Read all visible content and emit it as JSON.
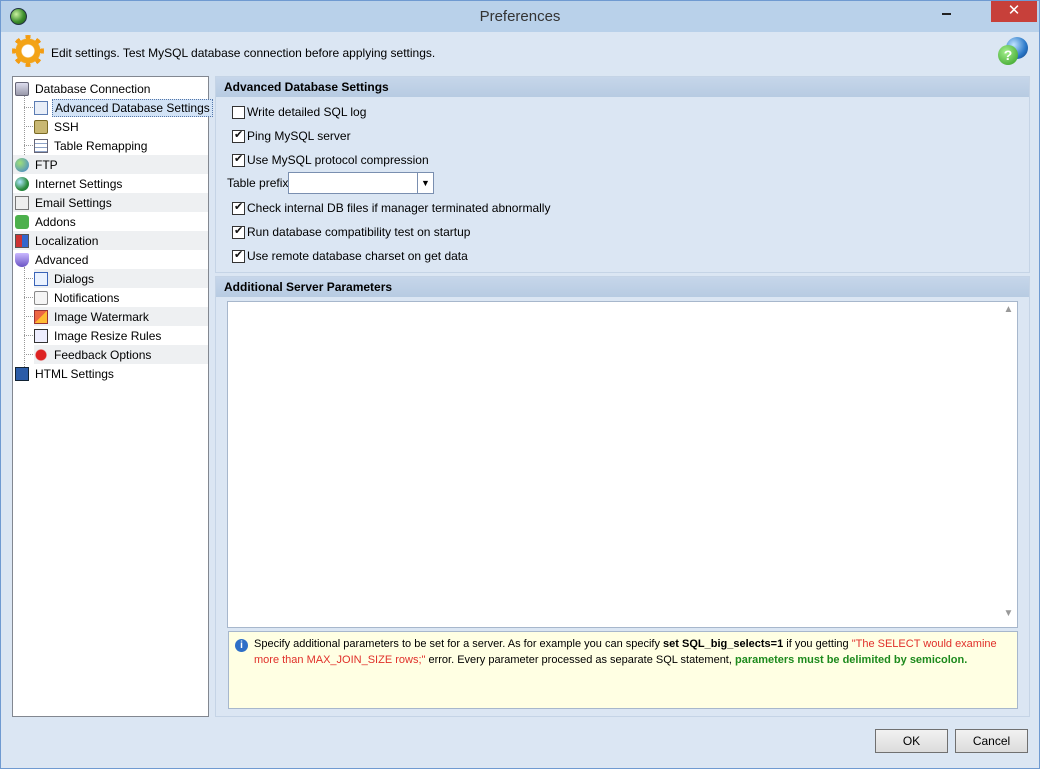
{
  "window": {
    "title": "Preferences",
    "close_glyph": "✕"
  },
  "header": {
    "text": "Edit settings. Test MySQL database connection before applying settings.",
    "help_glyph": "?"
  },
  "tree": {
    "items": [
      {
        "label": "Database Connection",
        "icon": "database-icon"
      },
      {
        "label": "Advanced Database Settings",
        "icon": "document-icon",
        "selected": true
      },
      {
        "label": "SSH",
        "icon": "lock-icon"
      },
      {
        "label": "Table Remapping",
        "icon": "table-icon"
      },
      {
        "label": "FTP",
        "icon": "ftp-icon"
      },
      {
        "label": "Internet Settings",
        "icon": "globe-icon"
      },
      {
        "label": "Email Settings",
        "icon": "envelope-icon"
      },
      {
        "label": "Addons",
        "icon": "puzzle-icon"
      },
      {
        "label": "Localization",
        "icon": "flag-icon"
      },
      {
        "label": "Advanced",
        "icon": "shield-icon"
      },
      {
        "label": "Dialogs",
        "icon": "dialog-icon"
      },
      {
        "label": "Notifications",
        "icon": "notification-icon"
      },
      {
        "label": "Image Watermark",
        "icon": "watermark-icon"
      },
      {
        "label": "Image Resize Rules",
        "icon": "resize-icon"
      },
      {
        "label": "Feedback Options",
        "icon": "bug-icon"
      },
      {
        "label": "HTML Settings",
        "icon": "html-icon"
      }
    ]
  },
  "advanced_db": {
    "title": "Advanced Database Settings",
    "options": [
      {
        "label": "Write detailed SQL log",
        "checked": false
      },
      {
        "label": "Ping MySQL server",
        "checked": true
      },
      {
        "label": "Use MySQL protocol compression",
        "checked": true
      },
      {
        "label": "Check internal DB files if manager terminated abnormally",
        "checked": true
      },
      {
        "label": "Run database compatibility test on startup",
        "checked": true
      },
      {
        "label": "Use remote database charset on get data",
        "checked": true
      }
    ],
    "table_prefix": {
      "label": "Table prefix",
      "value": ""
    }
  },
  "additional_params": {
    "title": "Additional Server Parameters",
    "value": "",
    "info": {
      "part1": "Specify additional parameters to be set for a server. As for example you can specify ",
      "code": "set SQL_big_selects=1",
      "part2": " if you getting ",
      "error_quote": "\"The SELECT would examine more than MAX_JOIN_SIZE rows;\"",
      "part3": " error. Every parameter processed as separate SQL statement, ",
      "emphasis": "parameters must be delimited by semicolon."
    }
  },
  "buttons": {
    "ok": "OK",
    "cancel": "Cancel"
  }
}
